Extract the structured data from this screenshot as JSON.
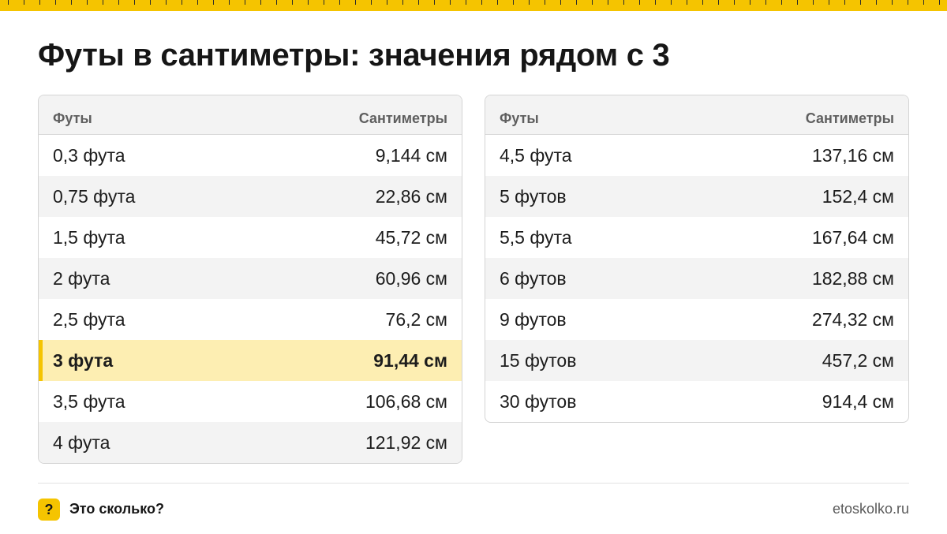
{
  "title": "Футы в сантиметры: значения рядом с 3",
  "table_left": {
    "headers": [
      "Футы",
      "Сантиметры"
    ],
    "rows": [
      {
        "feet": "0,3 фута",
        "cm": "9,144 см"
      },
      {
        "feet": "0,75 фута",
        "cm": "22,86 см"
      },
      {
        "feet": "1,5 фута",
        "cm": "45,72 см"
      },
      {
        "feet": "2 фута",
        "cm": "60,96 см"
      },
      {
        "feet": "2,5 фута",
        "cm": "76,2 см"
      },
      {
        "feet": "3 фута",
        "cm": "91,44 см",
        "highlight": true
      },
      {
        "feet": "3,5 фута",
        "cm": "106,68 см"
      },
      {
        "feet": "4 фута",
        "cm": "121,92 см"
      }
    ]
  },
  "table_right": {
    "headers": [
      "Футы",
      "Сантиметры"
    ],
    "rows": [
      {
        "feet": "4,5 фута",
        "cm": "137,16 см"
      },
      {
        "feet": "5 футов",
        "cm": "152,4 см"
      },
      {
        "feet": "5,5 фута",
        "cm": "167,64 см"
      },
      {
        "feet": "6 футов",
        "cm": "182,88 см"
      },
      {
        "feet": "9 футов",
        "cm": "274,32 см"
      },
      {
        "feet": "15 футов",
        "cm": "457,2 см"
      },
      {
        "feet": "30 футов",
        "cm": "914,4 см"
      }
    ]
  },
  "footer": {
    "icon_glyph": "?",
    "brand": "Это сколько?",
    "url": "etoskolko.ru"
  },
  "colors": {
    "accent": "#f5c400",
    "highlight_row": "#fdeeb2",
    "stripe_row": "#f3f3f3",
    "border": "#d4d4d4"
  },
  "icons": {
    "brand": "question-mark-icon"
  }
}
